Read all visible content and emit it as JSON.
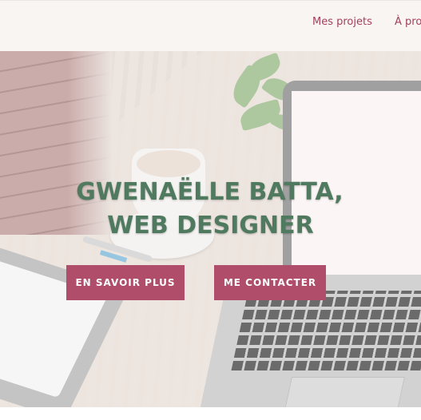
{
  "nav": {
    "items": [
      "Mes projets",
      "À propos"
    ]
  },
  "hero": {
    "headline_line1": "GWENAËLLE BATTA,",
    "headline_line2": "WEB DESIGNER",
    "primary_button": "EN SAVOIR PLUS",
    "secondary_button": "ME CONTACTER"
  },
  "colors": {
    "accent": "#b04d6a",
    "headline": "#4f7a5f",
    "nav_text": "#a43f5e",
    "header_bg": "#f8f5f3"
  }
}
